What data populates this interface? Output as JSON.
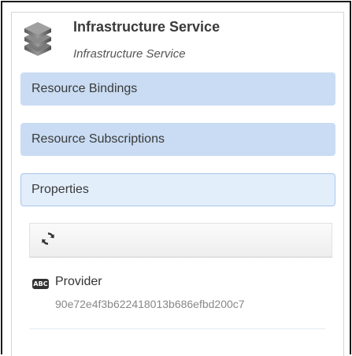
{
  "header": {
    "title": "Infrastructure Service",
    "subtitle": "Infrastructure Service",
    "icon": "stacked-disks-icon"
  },
  "nav": {
    "items": [
      {
        "label": "Resource Bindings"
      },
      {
        "label": "Resource Subscriptions"
      },
      {
        "label": "Properties"
      }
    ]
  },
  "toolbar": {
    "refresh_icon": "refresh-icon"
  },
  "properties": [
    {
      "type_badge": "ABC",
      "name": "Provider",
      "value": "90e72e4f3b622418013b686efbd200c7"
    }
  ],
  "colors": {
    "nav_fill": "#c9dcf3",
    "nav_selected_border": "#a9c6ea",
    "frame": "#1a1a1a"
  }
}
